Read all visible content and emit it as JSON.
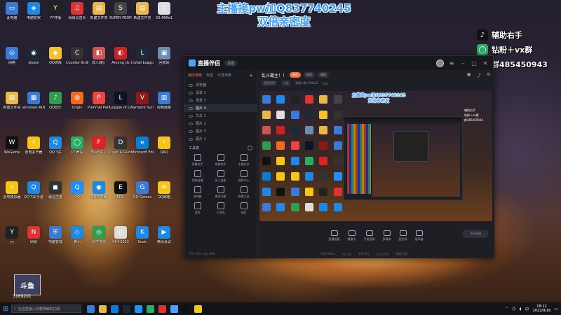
{
  "overlay": {
    "line1": "主播接pw加Q837740245",
    "line2": "双倍亲密度"
  },
  "side_promo": {
    "tiktok": "辅助右手",
    "wechat": "钻粉＋vx群",
    "qq": "群485450943"
  },
  "desktop_icons": [
    {
      "label": "此电脑",
      "color": "#3a7bd5",
      "glyph": "▭"
    },
    {
      "label": "电脑管家",
      "color": "#1e88e5",
      "glyph": "◈"
    },
    {
      "label": "YY开播",
      "color": "#222",
      "glyph": "Y"
    },
    {
      "label": "网易云音乐",
      "color": "#d33",
      "glyph": "♫"
    },
    {
      "label": "新建文件夹",
      "color": "#e8b84a",
      "glyph": "▤"
    },
    {
      "label": "SUPER PEOPLE",
      "color": "#444",
      "glyph": "S"
    },
    {
      "label": "新建文件夹",
      "color": "#e8b84a",
      "glyph": "▤"
    },
    {
      "label": "20.46ffe1",
      "color": "#ddd",
      "glyph": "▯"
    },
    {
      "label": "网络",
      "color": "#3a7bd5",
      "glyph": "◎"
    },
    {
      "label": "steam",
      "color": "#1b2838",
      "glyph": "◉"
    },
    {
      "label": "QQ游戏",
      "color": "#f6c12f",
      "glyph": "◆"
    },
    {
      "label": "Counter-Strike",
      "color": "#333",
      "glyph": "C"
    },
    {
      "label": "双人成行",
      "color": "#c55",
      "glyph": "◧"
    },
    {
      "label": "Among Us",
      "color": "#c22",
      "glyph": "◐"
    },
    {
      "label": "Install League",
      "color": "#1a2a3a",
      "glyph": "L"
    },
    {
      "label": "回收站",
      "color": "#6b8fb3",
      "glyph": "▣"
    },
    {
      "label": "新建文件夹",
      "color": "#e8b84a",
      "glyph": "▤"
    },
    {
      "label": "windows 照片",
      "color": "#3a7bd5",
      "glyph": "▦"
    },
    {
      "label": "QQ音乐",
      "color": "#2e9e4e",
      "glyph": "♪"
    },
    {
      "label": "Origin",
      "color": "#f06a1a",
      "glyph": "◍"
    },
    {
      "label": "Pummel Party",
      "color": "#e44",
      "glyph": "P"
    },
    {
      "label": "League of Legends",
      "color": "#0a1428",
      "glyph": "L"
    },
    {
      "label": "Vampire Survivors",
      "color": "#8a1a1a",
      "glyph": "V"
    },
    {
      "label": "控制面板",
      "color": "#3a7bd5",
      "glyph": "▥"
    },
    {
      "label": "WeGame",
      "color": "#111",
      "glyph": "W"
    },
    {
      "label": "雷电多开器",
      "color": "#f5c518",
      "glyph": "⚡"
    },
    {
      "label": "QQ飞车",
      "color": "#1e88e5",
      "glyph": "Q"
    },
    {
      "label": "PC微信",
      "color": "#2aae67",
      "glyph": "◯"
    },
    {
      "label": "Flash中心",
      "color": "#d22",
      "glyph": "F"
    },
    {
      "label": "Dyan & Guns",
      "color": "#333",
      "glyph": "D"
    },
    {
      "label": "Microsoft Edge",
      "color": "#0a7cd3",
      "glyph": "e"
    },
    {
      "label": "QAQ",
      "color": "#f5c518",
      "glyph": "⚡"
    },
    {
      "label": "雷电模拟器",
      "color": "#f5c518",
      "glyph": "⚡"
    },
    {
      "label": "QQ飞车手游",
      "color": "#1e88e5",
      "glyph": "Q"
    },
    {
      "label": "最强王者",
      "color": "#333",
      "glyph": "◼"
    },
    {
      "label": "QQ",
      "color": "#1e90ff",
      "glyph": "Q"
    },
    {
      "label": "QQ浏览器",
      "color": "#1e88e5",
      "glyph": "◉"
    },
    {
      "label": "EPIC",
      "color": "#111",
      "glyph": "E"
    },
    {
      "label": "QQ Games",
      "color": "#3a7bd5",
      "glyph": "G"
    },
    {
      "label": "QQ邮箱",
      "color": "#f5c518",
      "glyph": "✉"
    },
    {
      "label": "yy",
      "color": "#222",
      "glyph": "Y"
    },
    {
      "label": "网易",
      "color": "#d33",
      "glyph": "N"
    },
    {
      "label": "电脑管理",
      "color": "#3a7bd5",
      "glyph": "⛨"
    },
    {
      "label": "腾讯",
      "color": "#1e88e5",
      "glyph": "◇"
    },
    {
      "label": "软件管家",
      "color": "#2e9e4e",
      "glyph": "◎"
    },
    {
      "label": "584 2022",
      "color": "#ddd",
      "glyph": "▯"
    },
    {
      "label": "Kook",
      "color": "#1e88e5",
      "glyph": "K"
    },
    {
      "label": "腾讯会议",
      "color": "#1e88e5",
      "glyph": "▶"
    }
  ],
  "app": {
    "name": "直播伴侣",
    "chip": "设置",
    "left_tabs": [
      "我的场景",
      "双击",
      "可选场景"
    ],
    "add_symbol": "+",
    "scenes": [
      {
        "label": "浏览器",
        "selected": false
      },
      {
        "label": "场景 2",
        "selected": false
      },
      {
        "label": "场景 3",
        "selected": false
      },
      {
        "label": "图片 4",
        "selected": true
      },
      {
        "label": "文本 1",
        "selected": false
      },
      {
        "label": "图片 2",
        "selected": false
      },
      {
        "label": "图片 3",
        "selected": false
      },
      {
        "label": "图片 1",
        "selected": false
      }
    ],
    "tools_title": "工具箱",
    "tools": [
      "弹幕助手",
      "房管助手",
      "主播任务",
      "视频直播",
      "多人连麦",
      "福利中心",
      "说弹幕",
      "更多功能",
      "直播工具",
      "游戏",
      "小游戏",
      "抽奖"
    ],
    "footer": "CPU 35%  内存 68%",
    "room_title": "乱斗霸主！！",
    "room_pills": [
      "高光",
      "抽奖",
      "辅助"
    ],
    "room_sub": [
      "直播设置",
      "分区",
      "观看人数 214822",
      "143"
    ],
    "preview_text_1": "主播接pw加Q837740245",
    "preview_text_2": "双倍亲密度",
    "preview_side": [
      "辅助右手",
      "钻粉＋vx群",
      "群485450943"
    ],
    "controls": [
      "直播画面",
      "摄像头",
      "手机投屏",
      "多媒体",
      "麦克风",
      "扬声器"
    ],
    "go_live": "开始直播",
    "status": [
      "码率 0kb/s",
      "FPS 60",
      "丢帧 0%",
      "CPU 35%",
      "网络 良好"
    ]
  },
  "watermark": {
    "text": "斗鱼",
    "number": "3169201"
  },
  "taskbar": {
    "search_placeholder": "在这里输入你要搜索的内容",
    "time": "18:12",
    "date": "2022/9/16"
  }
}
